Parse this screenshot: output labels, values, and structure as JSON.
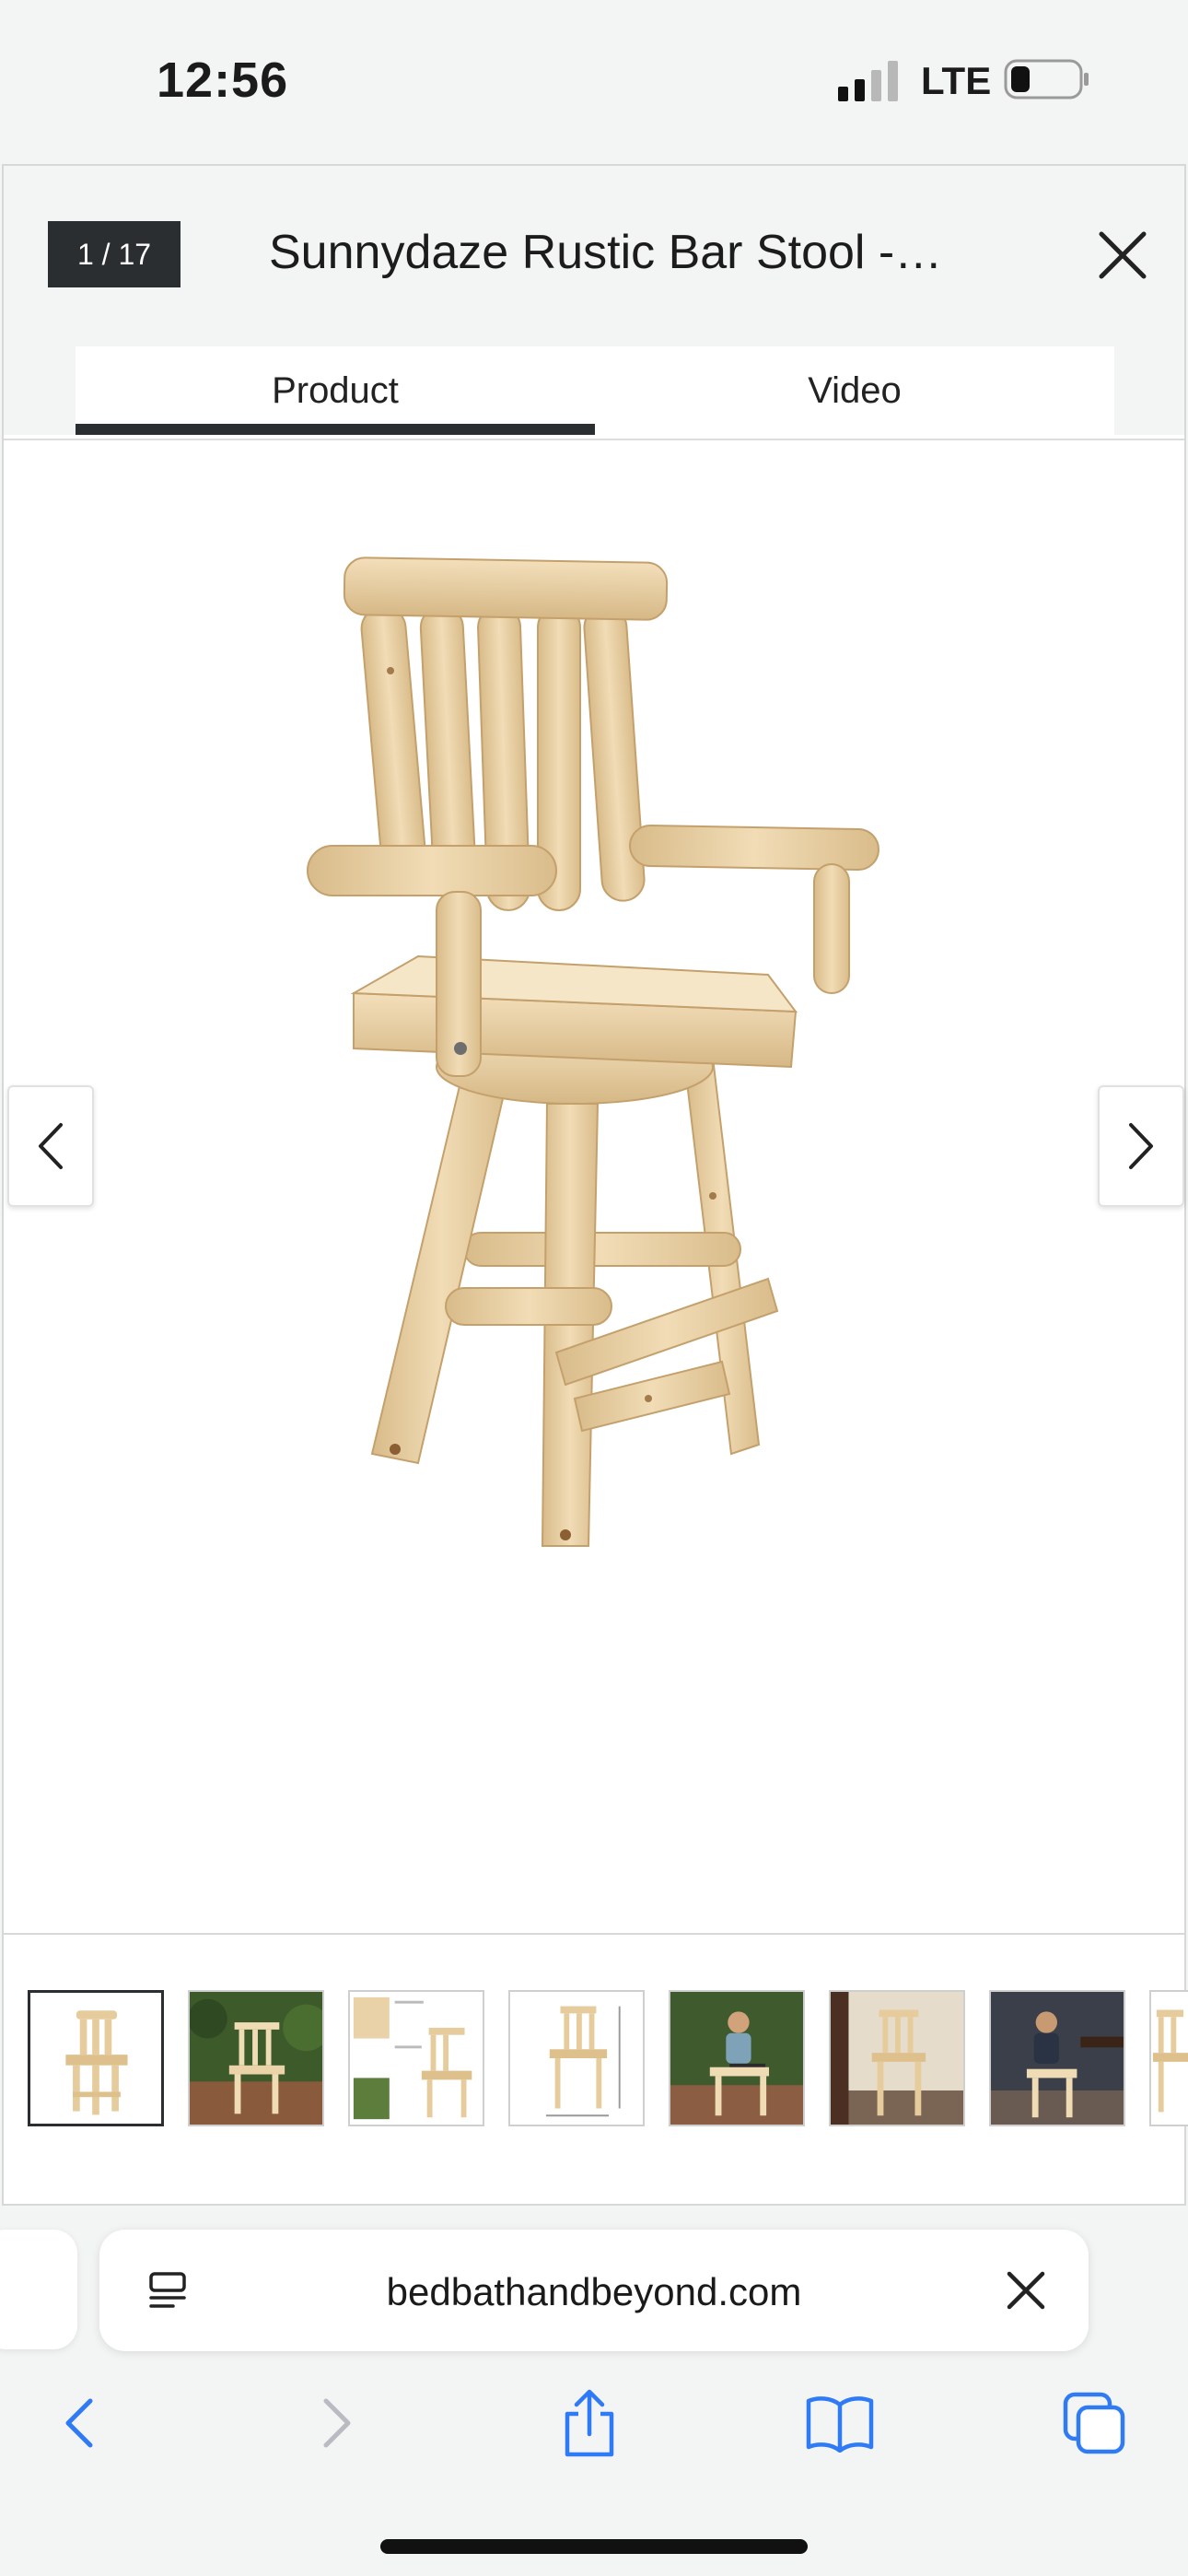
{
  "status": {
    "time": "12:56",
    "network": "LTE"
  },
  "modal": {
    "counter": "1 / 17",
    "title": "Sunnydaze Rustic Bar Stool -…",
    "tabs": [
      {
        "label": "Product",
        "active": true
      },
      {
        "label": "Video",
        "active": false
      }
    ],
    "thumbnails": [
      {
        "icon": "stool-thumb-icon",
        "active": true
      },
      {
        "icon": "garden-scene-thumb-icon",
        "active": false
      },
      {
        "icon": "feature-callouts-thumb-icon",
        "active": false
      },
      {
        "icon": "dimensions-thumb-icon",
        "active": false
      },
      {
        "icon": "person-seated-thumb-icon",
        "active": false
      },
      {
        "icon": "indoor-stool-thumb-icon",
        "active": false
      },
      {
        "icon": "person-at-bar-thumb-icon",
        "active": false
      },
      {
        "icon": "stool-partial-thumb-icon",
        "active": false
      }
    ]
  },
  "browser": {
    "url": "bedbathandbeyond.com",
    "toolbar": [
      "back-icon",
      "forward-icon",
      "share-icon",
      "bookmarks-icon",
      "tabs-icon"
    ]
  },
  "colors": {
    "accent": "#2b2e30",
    "ios_blue": "#2f7bf5",
    "wood": "#e9d2a8"
  }
}
